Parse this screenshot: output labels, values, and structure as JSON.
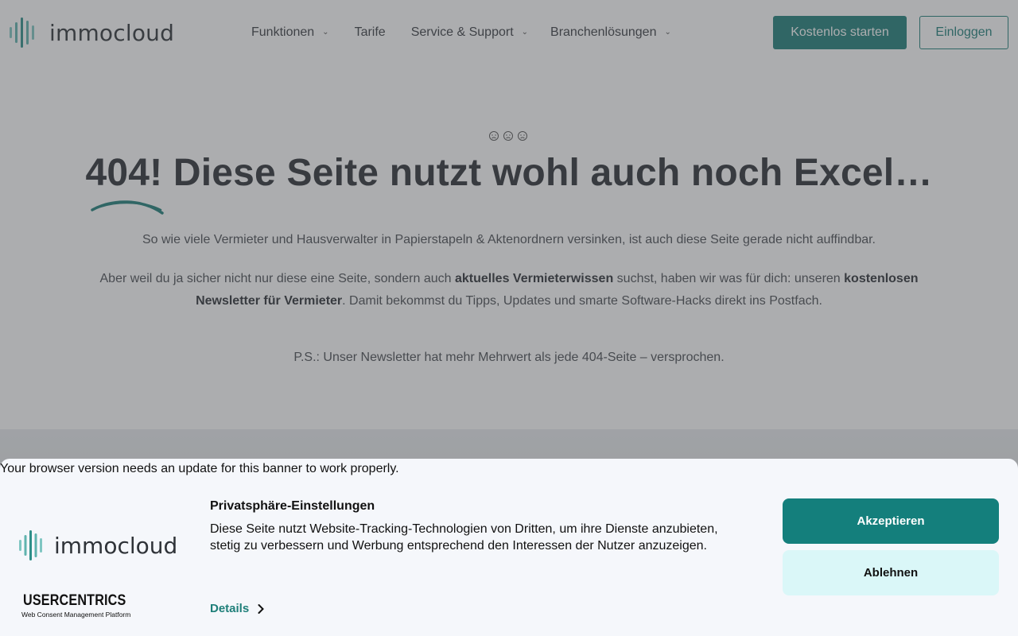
{
  "brand": {
    "name": "immocloud",
    "accent": "#1e7f79"
  },
  "nav": {
    "items": [
      {
        "label": "Funktionen",
        "has_dropdown": true
      },
      {
        "label": "Tarife",
        "has_dropdown": false
      },
      {
        "label": "Service & Support",
        "has_dropdown": true
      },
      {
        "label": "Branchenlösungen",
        "has_dropdown": true
      }
    ],
    "start_label": "Kostenlos starten",
    "login_label": "Einloggen"
  },
  "hero": {
    "faces": [
      "☹",
      "☹",
      "☹"
    ],
    "title": "404! Diese Seite nutzt wohl auch noch Excel…",
    "lead": "So wie viele Vermieter und Hausverwalter in Papierstapeln & Aktenordnern versinken, ist auch diese Seite gerade nicht auffindbar.",
    "para2_a": "Aber weil du ja sicher nicht nur diese eine Seite, sondern auch ",
    "para2_b": "aktuelles Vermieterwissen",
    "para2_c": " suchst, haben wir was für dich: unseren ",
    "para2_d": "kostenlosen Newsletter für Vermieter",
    "para2_e": ". Damit bekommst du Tipps, Updates und smarte Software-Hacks direkt ins Postfach.",
    "ps": "P.S.: Unser Newsletter hat mehr Mehrwert als jede 404-Seite – versprochen."
  },
  "consent": {
    "browser_warning": "Your browser version needs an update for this banner to work properly.",
    "title": "Privatsphäre-Einstellungen",
    "text": "Diese Seite nutzt Website-Tracking-Technologien von Dritten, um ihre Dienste anzubieten, stetig zu verbessern und Werbung entsprechend den Interessen der Nutzer anzuzeigen.",
    "details_label": "Details",
    "accept_label": "Akzeptieren",
    "deny_label": "Ablehnen",
    "provider_name": "USERCENTRICS",
    "provider_sub": "Web Consent Management Platform"
  }
}
